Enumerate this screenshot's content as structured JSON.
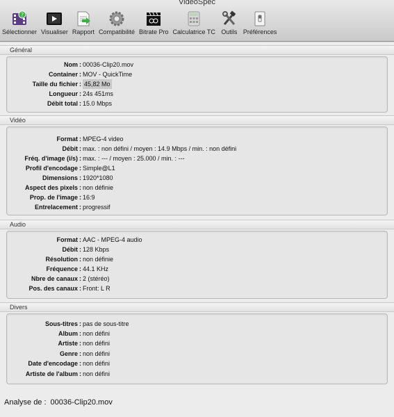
{
  "window": {
    "title": "VideoSpec"
  },
  "toolbar": [
    {
      "name": "selectionner-button",
      "icon": "film-icon",
      "label": "Sélectionner"
    },
    {
      "name": "visualiser-button",
      "icon": "play-icon",
      "label": "Visualiser"
    },
    {
      "name": "rapport-button",
      "icon": "report-icon",
      "label": "Rapport"
    },
    {
      "name": "compatibilite-button",
      "icon": "gear-icon",
      "label": "Compatibilité"
    },
    {
      "name": "bitrate-pro-button",
      "icon": "clapper-icon",
      "label": "Bitrate Pro"
    },
    {
      "name": "calculatrice-tc-button",
      "icon": "calculator-icon",
      "label": "Calculatrice TC"
    },
    {
      "name": "outils-button",
      "icon": "tools-icon",
      "label": "Outils"
    },
    {
      "name": "preferences-button",
      "icon": "switch-icon",
      "label": "Préférences"
    }
  ],
  "sections": {
    "general": {
      "title": "Général",
      "rows": [
        {
          "label": "Nom",
          "value": "00036-Clip20.mov"
        },
        {
          "label": "Container",
          "value": "MOV - QuickTime"
        },
        {
          "label": "Taille du fichier",
          "value": "45,82 Mo"
        },
        {
          "label": "Longueur",
          "value": "24s 451ms"
        },
        {
          "label": "Débit total",
          "value": "15.0 Mbps"
        }
      ]
    },
    "video": {
      "title": "Vidéo",
      "rows": [
        {
          "label": "Format",
          "value": "MPEG-4 video"
        },
        {
          "label": "Débit",
          "value": "max. : non défini / moyen : 14.9 Mbps / min. : non défini"
        },
        {
          "label": "Fréq. d'image (i/s)",
          "value": "max. : --- / moyen : 25.000 / min. : ---"
        },
        {
          "label": "Profil d'encodage",
          "value": "Simple@L1"
        },
        {
          "label": "Dimensions",
          "value": "1920*1080"
        },
        {
          "label": "Aspect des pixels",
          "value": "non définie"
        },
        {
          "label": "Prop. de l'image",
          "value": "16:9"
        },
        {
          "label": "Entrelacement",
          "value": "progressif"
        }
      ]
    },
    "audio": {
      "title": "Audio",
      "rows": [
        {
          "label": "Format",
          "value": "AAC - MPEG-4 audio"
        },
        {
          "label": "Débit",
          "value": "128 Kbps"
        },
        {
          "label": "Résolution",
          "value": "non définie"
        },
        {
          "label": "Fréquence",
          "value": "44.1 KHz"
        },
        {
          "label": "Nbre de canaux",
          "value": "2 (stéréo)"
        },
        {
          "label": "Pos. des canaux",
          "value": "Front: L R"
        }
      ]
    },
    "divers": {
      "title": "Divers",
      "rows": [
        {
          "label": "Sous-titres",
          "value": "pas de sous-titre"
        },
        {
          "label": "Album",
          "value": "non défini"
        },
        {
          "label": "Artiste",
          "value": "non défini"
        },
        {
          "label": "Genre",
          "value": "non défini"
        },
        {
          "label": "Date d'encodage",
          "value": "non défini"
        },
        {
          "label": "Artiste de l'album",
          "value": "non défini"
        }
      ]
    }
  },
  "footer": {
    "label": "Analyse de :",
    "filename": "00036-Clip20.mov"
  }
}
